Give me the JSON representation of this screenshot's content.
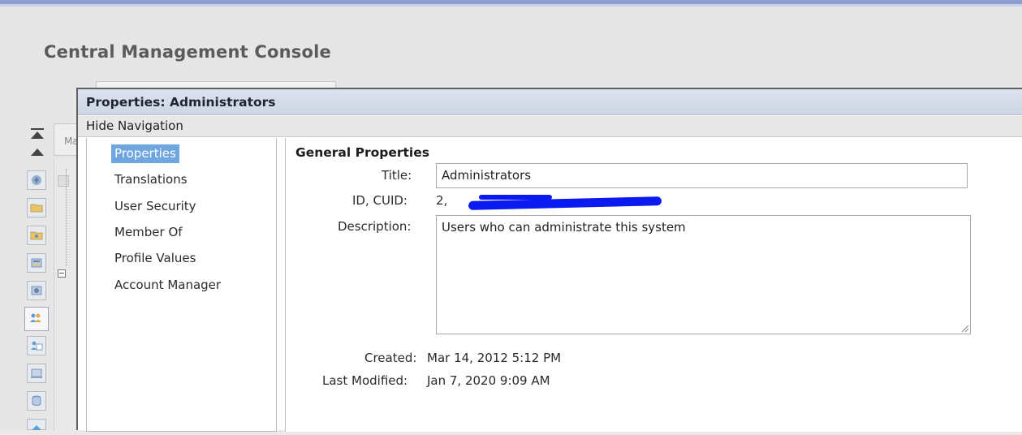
{
  "app": {
    "title": "Central Management Console"
  },
  "background": {
    "tab_label": "Ma"
  },
  "dialog": {
    "title": "Properties: Administrators",
    "nav_toggle": "Hide Navigation",
    "nav_items": [
      {
        "label": "Properties",
        "selected": true
      },
      {
        "label": "Translations",
        "selected": false
      },
      {
        "label": "User Security",
        "selected": false
      },
      {
        "label": "Member Of",
        "selected": false
      },
      {
        "label": "Profile Values",
        "selected": false
      },
      {
        "label": "Account Manager",
        "selected": false
      }
    ],
    "general": {
      "heading": "General Properties",
      "title_label": "Title:",
      "title_value": "Administrators",
      "id_label": "ID, CUID:",
      "id_value": "2,",
      "description_label": "Description:",
      "description_value": "Users who can administrate this system",
      "created_label": "Created:",
      "created_value": "Mar 14, 2012 5:12 PM",
      "modified_label": "Last Modified:",
      "modified_value": "Jan 7, 2020 9:09 AM"
    }
  },
  "side_icons": [
    "cmc-home-icon",
    "folders-icon",
    "personal-folders-icon",
    "categories-icon",
    "personal-categories-icon",
    "users-groups-icon",
    "inboxes-icon",
    "servers-icon",
    "databases-icon",
    "applications-icon"
  ],
  "colors": {
    "header_stripe": "#8e9ccf",
    "dialog_titlebar": "#cdd6e4",
    "selected_nav": "#6fa6df",
    "redaction": "#0a1af0"
  }
}
